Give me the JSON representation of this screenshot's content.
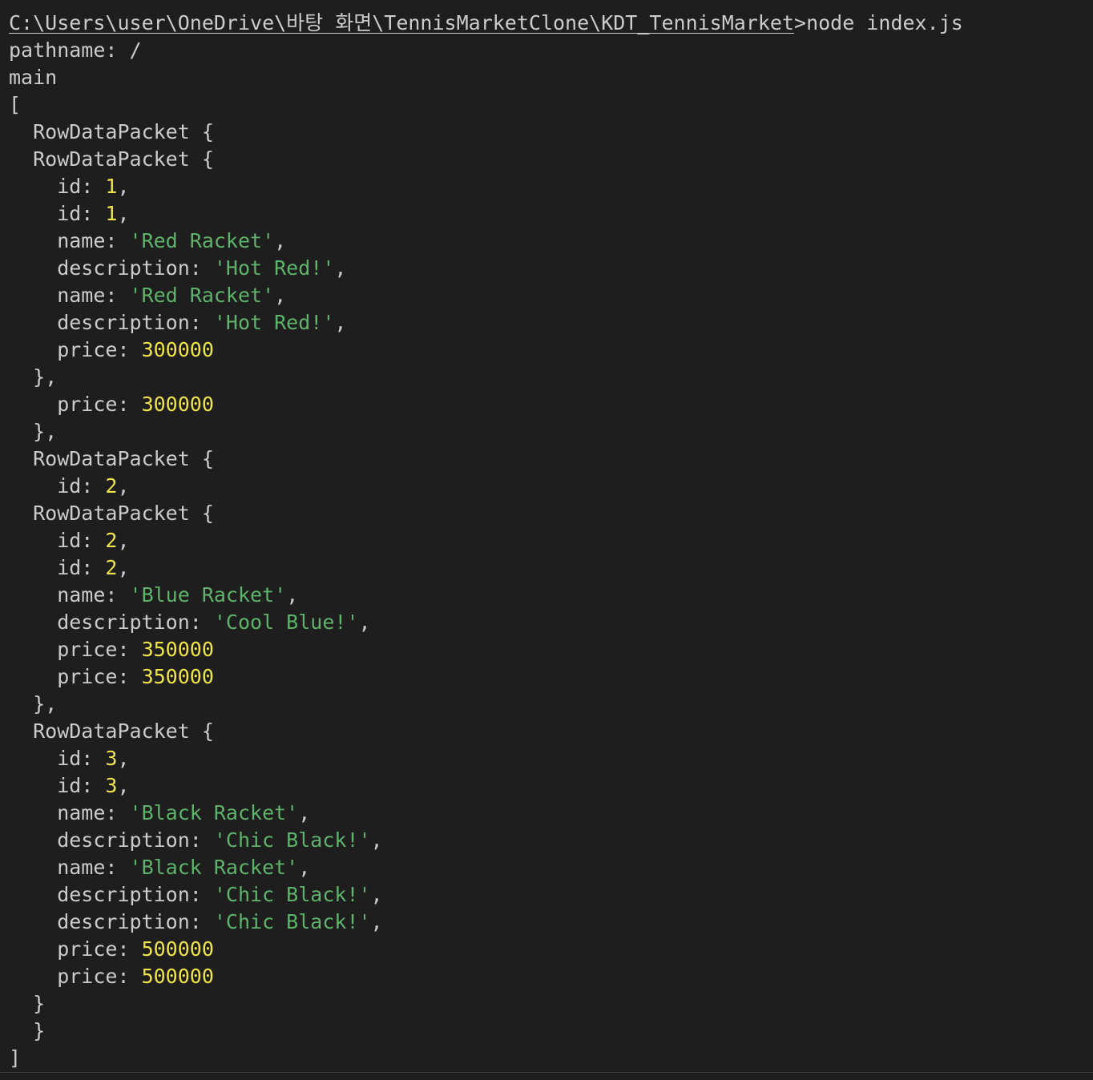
{
  "terminal": {
    "colors": {
      "background": "#1e1e1e",
      "text": "#cccccc",
      "string": "#5fb36b",
      "number": "#f0e44c"
    },
    "lines": [
      [
        {
          "t": "C:\\Users\\user\\OneDrive\\바탕 화면\\TennisMarketClone\\KDT_TennisMarket",
          "c": "path"
        },
        {
          "t": ">node index.js",
          "c": "txt"
        }
      ],
      [
        {
          "t": "pathname: /",
          "c": "txt"
        }
      ],
      [
        {
          "t": "main",
          "c": "txt"
        }
      ],
      [
        {
          "t": "[",
          "c": "txt"
        }
      ],
      [
        {
          "t": "  RowDataPacket {",
          "c": "txt"
        }
      ],
      [
        {
          "t": "  RowDataPacket {",
          "c": "txt"
        }
      ],
      [
        {
          "t": "    id: ",
          "c": "txt"
        },
        {
          "t": "1",
          "c": "num"
        },
        {
          "t": ",",
          "c": "txt"
        }
      ],
      [
        {
          "t": "    id: ",
          "c": "txt"
        },
        {
          "t": "1",
          "c": "num"
        },
        {
          "t": ",",
          "c": "txt"
        }
      ],
      [
        {
          "t": "    name: ",
          "c": "txt"
        },
        {
          "t": "'Red Racket'",
          "c": "str"
        },
        {
          "t": ",",
          "c": "txt"
        }
      ],
      [
        {
          "t": "    description: ",
          "c": "txt"
        },
        {
          "t": "'Hot Red!'",
          "c": "str"
        },
        {
          "t": ",",
          "c": "txt"
        }
      ],
      [
        {
          "t": "    name: ",
          "c": "txt"
        },
        {
          "t": "'Red Racket'",
          "c": "str"
        },
        {
          "t": ",",
          "c": "txt"
        }
      ],
      [
        {
          "t": "    description: ",
          "c": "txt"
        },
        {
          "t": "'Hot Red!'",
          "c": "str"
        },
        {
          "t": ",",
          "c": "txt"
        }
      ],
      [
        {
          "t": "    price: ",
          "c": "txt"
        },
        {
          "t": "300000",
          "c": "num"
        }
      ],
      [
        {
          "t": "  },",
          "c": "txt"
        }
      ],
      [
        {
          "t": "    price: ",
          "c": "txt"
        },
        {
          "t": "300000",
          "c": "num"
        }
      ],
      [
        {
          "t": "  },",
          "c": "txt"
        }
      ],
      [
        {
          "t": "  RowDataPacket {",
          "c": "txt"
        }
      ],
      [
        {
          "t": "    id: ",
          "c": "txt"
        },
        {
          "t": "2",
          "c": "num"
        },
        {
          "t": ",",
          "c": "txt"
        }
      ],
      [
        {
          "t": "  RowDataPacket {",
          "c": "txt"
        }
      ],
      [
        {
          "t": "    id: ",
          "c": "txt"
        },
        {
          "t": "2",
          "c": "num"
        },
        {
          "t": ",",
          "c": "txt"
        }
      ],
      [
        {
          "t": "    id: ",
          "c": "txt"
        },
        {
          "t": "2",
          "c": "num"
        },
        {
          "t": ",",
          "c": "txt"
        }
      ],
      [
        {
          "t": "    name: ",
          "c": "txt"
        },
        {
          "t": "'Blue Racket'",
          "c": "str"
        },
        {
          "t": ",",
          "c": "txt"
        }
      ],
      [
        {
          "t": "    description: ",
          "c": "txt"
        },
        {
          "t": "'Cool Blue!'",
          "c": "str"
        },
        {
          "t": ",",
          "c": "txt"
        }
      ],
      [
        {
          "t": "    price: ",
          "c": "txt"
        },
        {
          "t": "350000",
          "c": "num"
        }
      ],
      [
        {
          "t": "    price: ",
          "c": "txt"
        },
        {
          "t": "350000",
          "c": "num"
        }
      ],
      [
        {
          "t": "  },",
          "c": "txt"
        }
      ],
      [
        {
          "t": "  RowDataPacket {",
          "c": "txt"
        }
      ],
      [
        {
          "t": "    id: ",
          "c": "txt"
        },
        {
          "t": "3",
          "c": "num"
        },
        {
          "t": ",",
          "c": "txt"
        }
      ],
      [
        {
          "t": "    id: ",
          "c": "txt"
        },
        {
          "t": "3",
          "c": "num"
        },
        {
          "t": ",",
          "c": "txt"
        }
      ],
      [
        {
          "t": "    name: ",
          "c": "txt"
        },
        {
          "t": "'Black Racket'",
          "c": "str"
        },
        {
          "t": ",",
          "c": "txt"
        }
      ],
      [
        {
          "t": "    description: ",
          "c": "txt"
        },
        {
          "t": "'Chic Black!'",
          "c": "str"
        },
        {
          "t": ",",
          "c": "txt"
        }
      ],
      [
        {
          "t": "    name: ",
          "c": "txt"
        },
        {
          "t": "'Black Racket'",
          "c": "str"
        },
        {
          "t": ",",
          "c": "txt"
        }
      ],
      [
        {
          "t": "    description: ",
          "c": "txt"
        },
        {
          "t": "'Chic Black!'",
          "c": "str"
        },
        {
          "t": ",",
          "c": "txt"
        }
      ],
      [
        {
          "t": "    description: ",
          "c": "txt"
        },
        {
          "t": "'Chic Black!'",
          "c": "str"
        },
        {
          "t": ",",
          "c": "txt"
        }
      ],
      [
        {
          "t": "    price: ",
          "c": "txt"
        },
        {
          "t": "500000",
          "c": "num"
        }
      ],
      [
        {
          "t": "    price: ",
          "c": "txt"
        },
        {
          "t": "500000",
          "c": "num"
        }
      ],
      [
        {
          "t": "  }",
          "c": "txt"
        }
      ],
      [
        {
          "t": "  }",
          "c": "txt"
        }
      ],
      [
        {
          "t": "]",
          "c": "txt"
        }
      ]
    ]
  }
}
